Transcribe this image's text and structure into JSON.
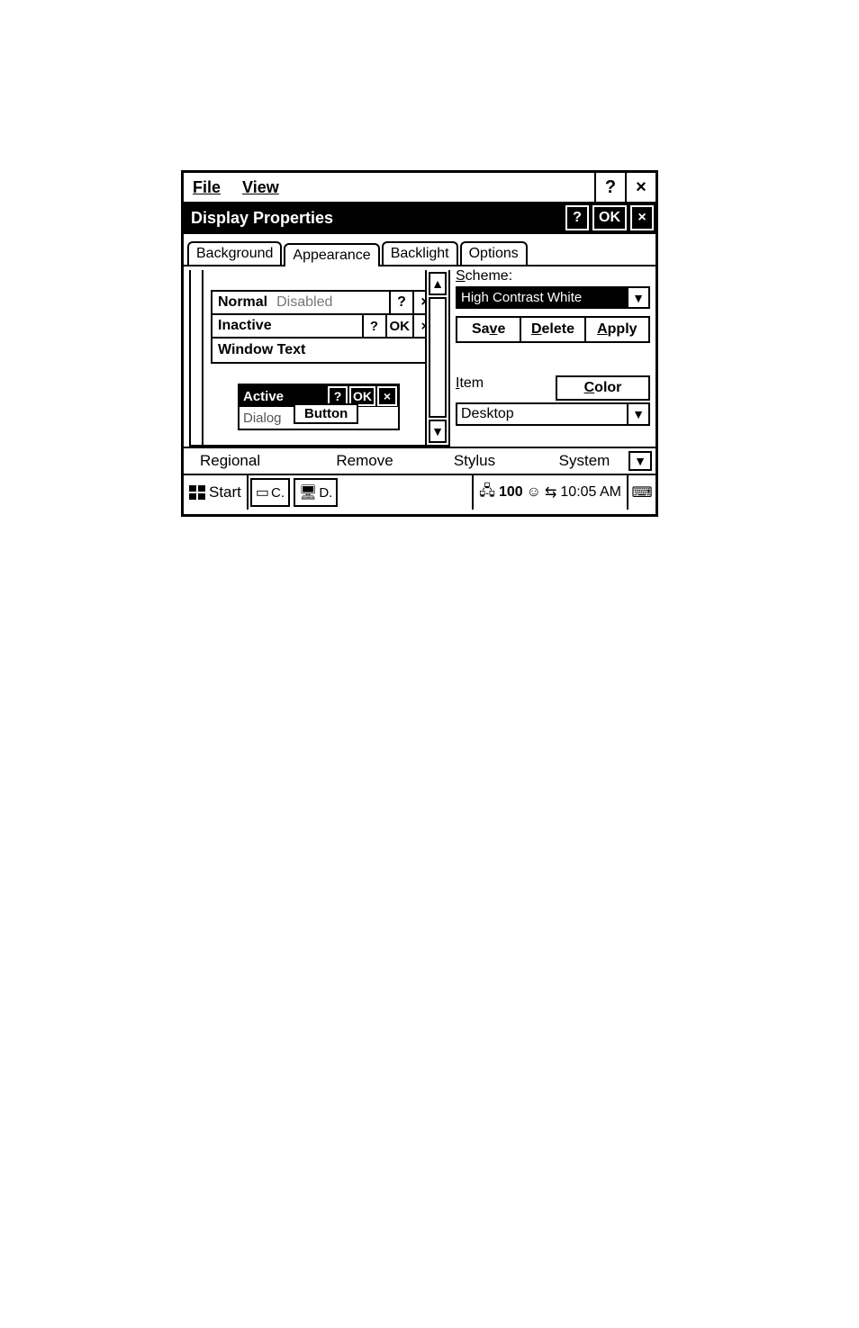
{
  "shell": {
    "menu": {
      "file": "File",
      "view": "View"
    },
    "help": "?",
    "close": "×"
  },
  "dialog": {
    "title": "Display Properties",
    "help": "?",
    "ok": "OK",
    "close": "×"
  },
  "tabs": {
    "background": "Background",
    "appearance": "Appearance",
    "backlight": "Backlight",
    "options": "Options"
  },
  "preview": {
    "normal": "Normal",
    "disabled": "Disabled",
    "help": "?",
    "close": "×",
    "inactive": "Inactive",
    "ok": "OK",
    "window_text": "Window Text",
    "active": "Active",
    "button": "Button",
    "dialog": "Dialog"
  },
  "scheme": {
    "label_s": "S",
    "label_rest": "cheme:",
    "value": "High Contrast White",
    "save": "Save",
    "delete": "Delete",
    "apply": "Apply"
  },
  "item": {
    "label_i": "I",
    "label_rest": "tem",
    "value": "Desktop",
    "color_c": "C",
    "color_rest": "olor"
  },
  "commands": {
    "regional": "Regional",
    "remove": "Remove",
    "stylus": "Stylus",
    "system": "System"
  },
  "taskbar": {
    "start": "Start",
    "task_c": "C.",
    "task_d": "D.",
    "battery": "100",
    "time": "10:05 AM"
  }
}
